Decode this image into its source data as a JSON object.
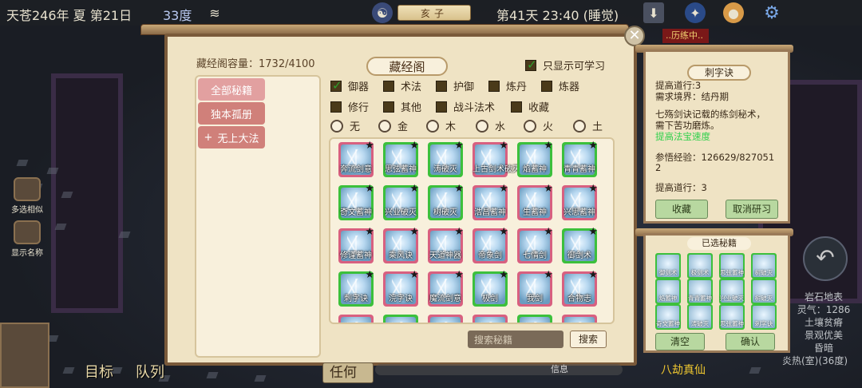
{
  "topbar": {
    "date": "天苍246年 夏 第21日",
    "temperature": "33度",
    "day_symbol": "亥子",
    "day_time": "第41天 23:40 (睡觉)"
  },
  "side_buttons": [
    "多选相似",
    "显示名称"
  ],
  "main": {
    "capacity": "藏经阁容量：1732/4100",
    "title": "藏经阁",
    "learnable_only": "只显示可学习",
    "categories": [
      "全部秘籍",
      "独本孤册",
      "无上大法"
    ],
    "filters_row1": [
      {
        "label": "御器",
        "checked": true
      },
      {
        "label": "术法",
        "checked": false
      },
      {
        "label": "护御",
        "checked": false
      },
      {
        "label": "炼丹",
        "checked": false
      },
      {
        "label": "炼器",
        "checked": false
      }
    ],
    "filters_row2": [
      {
        "label": "修行",
        "checked": false
      },
      {
        "label": "其他",
        "checked": false
      },
      {
        "label": "战斗法术",
        "checked": false
      },
      {
        "label": "收藏",
        "checked": false
      }
    ],
    "elements": [
      "无",
      "金",
      "木",
      "水",
      "火",
      "土"
    ],
    "books": [
      [
        "奔流剑意",
        "思弦蓄神",
        "涛破灭",
        "上古剑术破灭",
        "焰蓄神",
        "青青蓄神"
      ],
      [
        "奇文蓄神",
        "兴业破灭",
        "树破灭",
        "浩昌蓄神",
        "生蓄神",
        "兴思蓄神"
      ],
      [
        "修谨蓄神",
        "乘风诀",
        "天道神器",
        "帝象剑",
        "七情剑",
        "御剑术"
      ],
      [
        "刺字诀",
        "浣字诀",
        "魔流剑意",
        "极剑",
        "我剑",
        "合物志"
      ]
    ],
    "book_colors": [
      [
        "pink",
        "green",
        "green",
        "pink",
        "green",
        "green"
      ],
      [
        "green",
        "green",
        "green",
        "pink",
        "pink",
        "pink"
      ],
      [
        "pink",
        "pink",
        "pink",
        "pink",
        "pink",
        "green"
      ],
      [
        "green",
        "pink",
        "pink",
        "green",
        "pink",
        "pink"
      ]
    ],
    "search_placeholder": "搜索秘籍",
    "search_button": "搜索"
  },
  "training_badge": "..历练中..",
  "info": {
    "name": "刺字诀",
    "lines": [
      "提高道行:3",
      "需求境界：结丹期"
    ],
    "desc1": "七殇剑诀记载的练剑秘术，",
    "desc2": "需下苦功磨炼。",
    "bonus": "提高法宝速度",
    "exp1": "参悟经验：126629/827051",
    "exp2": "2",
    "effect": "提高道行：3",
    "collect": "收藏",
    "cancel": "取消研习"
  },
  "selected": {
    "title": "已选秘籍",
    "items": [
      "御剑术",
      "极剑术",
      "思弦蓄神",
      "树破灭",
      "焰蓄神",
      "青青蓄神",
      "兴业破灭",
      "树破灭",
      "奇文蓄神",
      "涛破灭",
      "思弦蓄神",
      "刺字诀"
    ],
    "clear": "清空",
    "confirm": "确认"
  },
  "terrain": [
    "岩石地表",
    "灵气：1286",
    "土壤贫瘠",
    "景观优美",
    "昏暗"
  ],
  "bottom": {
    "target": "目标",
    "team": "队列",
    "anyone": "任何",
    "message": "信息",
    "realm": "八劫真仙",
    "weather": "炎热(室)(36度)"
  }
}
